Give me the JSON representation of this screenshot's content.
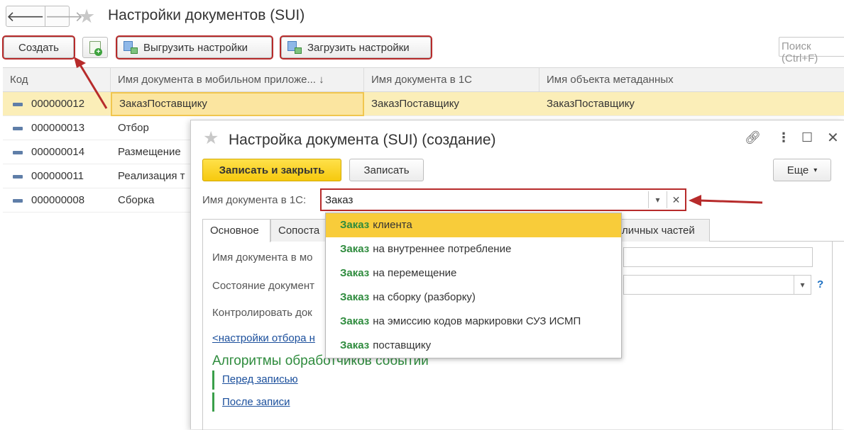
{
  "header": {
    "back_icon": "arrow-left-icon",
    "forward_icon": "arrow-right-icon",
    "favorite_icon": "star-icon",
    "title": "Настройки документов (SUI)"
  },
  "toolbar": {
    "create_label": "Создать",
    "copy_icon": "add-document-icon",
    "export_label": "Выгрузить настройки",
    "import_label": "Загрузить настройки",
    "search_placeholder": "Поиск (Ctrl+F)"
  },
  "table": {
    "columns": [
      "Код",
      "Имя документа в мобильном приложе... ↓",
      "Имя документа в 1С",
      "Имя объекта метаданных"
    ],
    "rows": [
      {
        "code": "000000012",
        "mobile_name": "ЗаказПоставщику",
        "name_1c": "ЗаказПоставщику",
        "metadata": "ЗаказПоставщику"
      },
      {
        "code": "000000013",
        "mobile_name": "Отбор",
        "name_1c": "",
        "metadata": ""
      },
      {
        "code": "000000014",
        "mobile_name": "Размещение",
        "name_1c": "",
        "metadata": ""
      },
      {
        "code": "000000011",
        "mobile_name": "Реализация т",
        "name_1c": "",
        "metadata": ""
      },
      {
        "code": "000000008",
        "mobile_name": "Сборка",
        "name_1c": "",
        "metadata": ""
      }
    ]
  },
  "dialog": {
    "title": "Настройка документа (SUI) (создание)",
    "write_close_label": "Записать и закрыть",
    "write_label": "Записать",
    "more_label": "Еще",
    "doc_name_label": "Имя документа в 1С:",
    "doc_name_value": "Заказ",
    "tabs": [
      "Основное",
      "Сопоста",
      "личных частей"
    ],
    "mobile_name_label": "Имя документа в мо",
    "state_label": "Состояние документ",
    "control_label": "Контролировать док",
    "filter_link": "<настройки отбора н",
    "help_mark": "?",
    "algorithms_heading": "Алгоритмы обработчиков событий",
    "before_write_link": "Перед записью",
    "after_write_link": "После записи"
  },
  "dropdown": {
    "match": "Заказ",
    "items": [
      {
        "match": "Заказ",
        "rest": "клиента"
      },
      {
        "match": "Заказ",
        "rest": "на внутреннее потребление"
      },
      {
        "match": "Заказ",
        "rest": "на перемещение"
      },
      {
        "match": "Заказ",
        "rest": "на сборку (разборку)"
      },
      {
        "match": "Заказ",
        "rest": "на эмиссию кодов маркировки СУЗ ИСМП"
      },
      {
        "match": "Заказ",
        "rest": "поставщику"
      }
    ]
  },
  "colors": {
    "accent_red": "#b72b2b",
    "highlight_yellow": "#f8cc3a",
    "selected_row": "#fbeeb8",
    "match_green": "#2e8b3d",
    "link_blue": "#1b4f9c"
  }
}
